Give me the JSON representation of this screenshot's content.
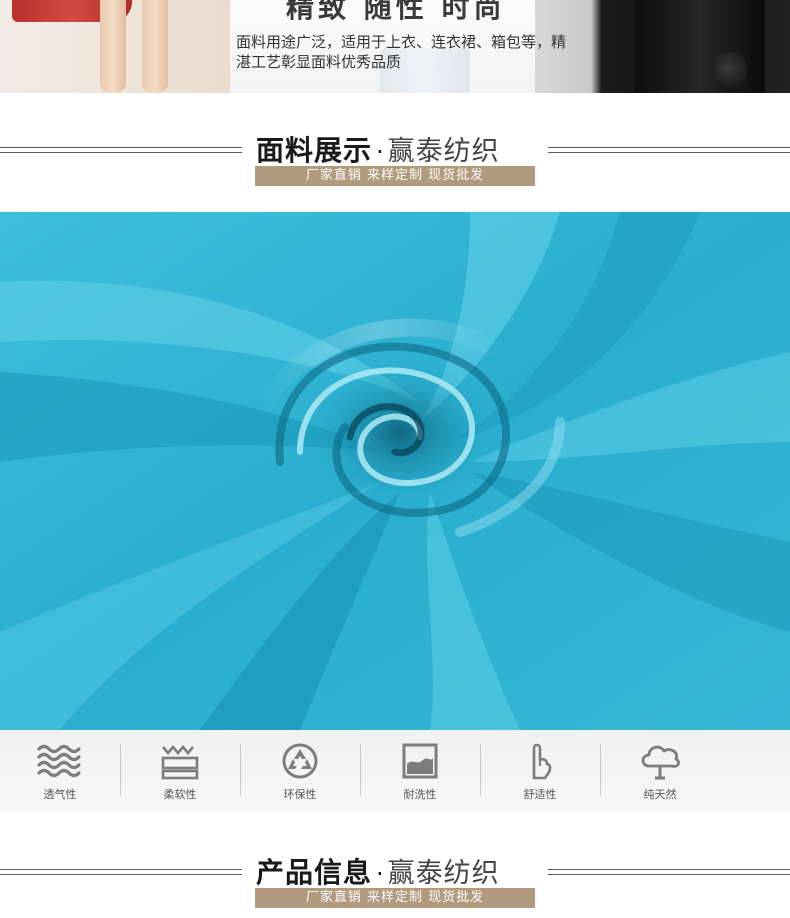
{
  "banner": {
    "headline": "精致 随性 时尚",
    "description": "面料用途广泛，适用于上衣、连衣裙、箱包等，精湛工艺彰显面料优秀品质"
  },
  "section_fabric": {
    "title_strong": "面料展示",
    "dot": "·",
    "title_light": "赢泰纺织",
    "tagline": "厂家直销 来样定制 现货批发"
  },
  "fabric_photo": {
    "subject": "teal-swirled-fabric",
    "color": "#2fb3d2"
  },
  "features": [
    {
      "label": "透气性",
      "icon": "waves-icon"
    },
    {
      "label": "柔软性",
      "icon": "softness-icon"
    },
    {
      "label": "环保性",
      "icon": "recycle-icon"
    },
    {
      "label": "耐洗性",
      "icon": "wash-icon"
    },
    {
      "label": "舒适性",
      "icon": "hand-icon"
    },
    {
      "label": "纯天然",
      "icon": "tree-icon"
    }
  ],
  "section_info": {
    "title_strong": "产品信息",
    "dot": "·",
    "title_light": "赢泰纺织",
    "tagline": "厂家直销 来样定制 现货批发"
  },
  "colors": {
    "tagline_bg": "#b19a7e",
    "icon_gray": "#7c7c7c",
    "fabric_teal": "#2fb3d2"
  }
}
